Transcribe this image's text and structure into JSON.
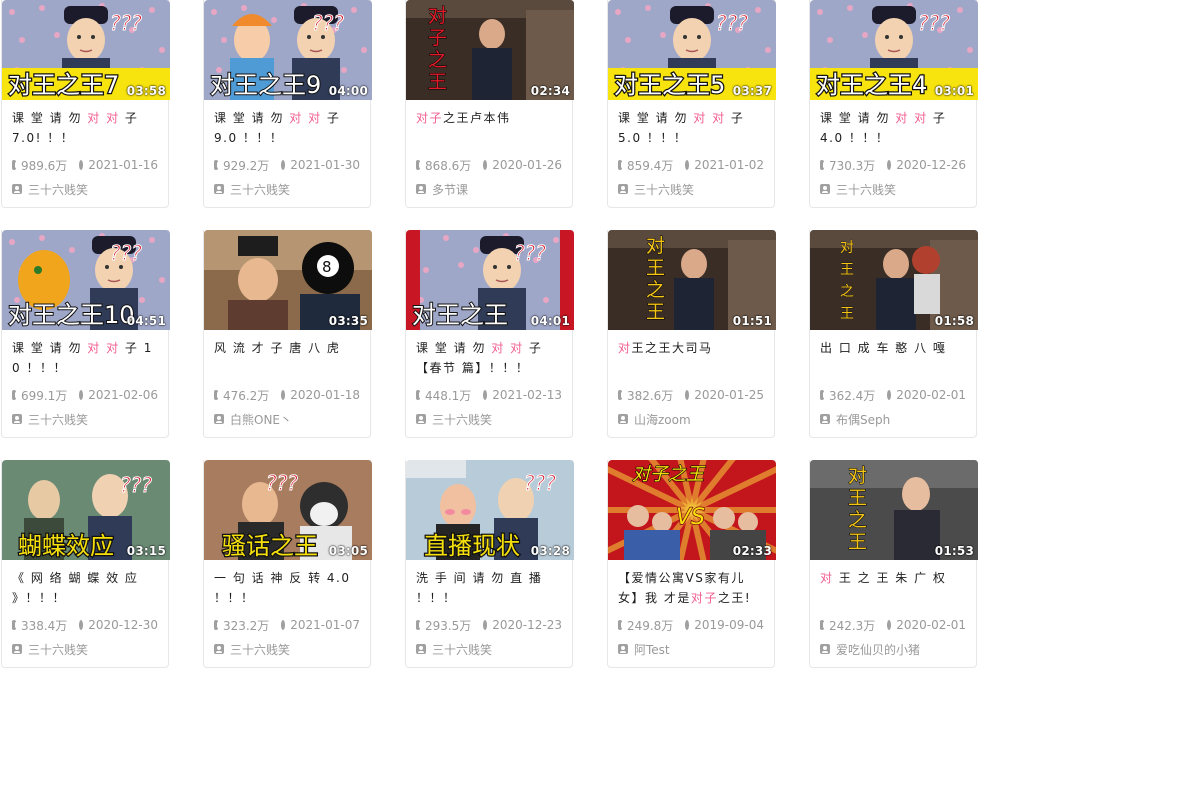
{
  "videos": [
    {
      "thumb_caption": "对王之王7",
      "duration": "03:58",
      "title": [
        [
          "课 堂 请 勿 ",
          false
        ],
        [
          "对 对",
          true
        ],
        [
          " 子 7.0! ！！",
          false
        ]
      ],
      "plays": "989.6万",
      "date": "2021-01-16",
      "uploader": "三十六贱笑",
      "theme": "teacher"
    },
    {
      "thumb_caption": "对王之王9",
      "duration": "04:00",
      "title": [
        [
          "课 堂 请 勿 ",
          false
        ],
        [
          "对 对",
          true
        ],
        [
          " 子 9.0 ！！！",
          false
        ]
      ],
      "plays": "929.2万",
      "date": "2021-01-30",
      "uploader": "三十六贱笑",
      "theme": "teacher2"
    },
    {
      "thumb_caption": "对子之王",
      "duration": "02:34",
      "title": [
        [
          "对子",
          true
        ],
        [
          "之王卢本伟",
          false
        ]
      ],
      "plays": "868.6万",
      "date": "2020-01-26",
      "uploader": "多节课",
      "theme": "drama-red"
    },
    {
      "thumb_caption": "对王之王5",
      "duration": "03:37",
      "title": [
        [
          "课 堂 请 勿 ",
          false
        ],
        [
          "对 对",
          true
        ],
        [
          " 子 5.0 ！！！",
          false
        ]
      ],
      "plays": "859.4万",
      "date": "2021-01-02",
      "uploader": "三十六贱笑",
      "theme": "teacher"
    },
    {
      "thumb_caption": "对王之王4",
      "duration": "03:01",
      "title": [
        [
          "课 堂 请 勿 ",
          false
        ],
        [
          "对 对",
          true
        ],
        [
          " 子 4.0 ！！！",
          false
        ]
      ],
      "plays": "730.3万",
      "date": "2020-12-26",
      "uploader": "三十六贱笑",
      "theme": "teacher"
    },
    {
      "thumb_caption": "对王之王10",
      "duration": "04:51",
      "title": [
        [
          "课 堂 请 勿 ",
          false
        ],
        [
          "对 对",
          true
        ],
        [
          " 子 10 ！！！",
          false
        ]
      ],
      "plays": "699.1万",
      "date": "2021-02-06",
      "uploader": "三十六贱笑",
      "theme": "teacher-dino"
    },
    {
      "thumb_caption": "",
      "duration": "03:35",
      "title": [
        [
          "风 流 才 子 唐 八 虎",
          false
        ]
      ],
      "plays": "476.2万",
      "date": "2020-01-18",
      "uploader": "白熊ONE丶",
      "theme": "ball"
    },
    {
      "thumb_caption": "对王之王",
      "duration": "04:01",
      "title": [
        [
          "课 堂 请 勿 ",
          false
        ],
        [
          "对 对",
          true
        ],
        [
          " 子 【春节 篇】！！！",
          false
        ]
      ],
      "plays": "448.1万",
      "date": "2021-02-13",
      "uploader": "三十六贱笑",
      "theme": "teacher-ny"
    },
    {
      "thumb_caption": "对王之王",
      "duration": "01:51",
      "title": [
        [
          "对",
          true
        ],
        [
          "王之王大司马",
          false
        ]
      ],
      "plays": "382.6万",
      "date": "2020-01-25",
      "uploader": "山海zoom",
      "theme": "drama-yellow"
    },
    {
      "thumb_caption": "对王之王",
      "duration": "01:58",
      "title": [
        [
          "出 口 成 车 憨 八 嘎",
          false
        ]
      ],
      "plays": "362.4万",
      "date": "2020-02-01",
      "uploader": "布偶Seph",
      "theme": "drama-anime"
    },
    {
      "thumb_caption": "蝴蝶效应",
      "duration": "03:15",
      "title": [
        [
          "《 网 络 蝴 蝶 效 应 》！！！",
          false
        ]
      ],
      "plays": "338.4万",
      "date": "2020-12-30",
      "uploader": "三十六贱笑",
      "theme": "butterfly"
    },
    {
      "thumb_caption": "骚话之王",
      "duration": "03:05",
      "title": [
        [
          "一 句 话 神 反 转 4.0 ！！！",
          false
        ]
      ],
      "plays": "323.2万",
      "date": "2021-01-07",
      "uploader": "三十六贱笑",
      "theme": "dog"
    },
    {
      "thumb_caption": "直播现状",
      "duration": "03:28",
      "title": [
        [
          "洗 手 间 请 勿 直 播 ！！！",
          false
        ]
      ],
      "plays": "293.5万",
      "date": "2020-12-23",
      "uploader": "三十六贱笑",
      "theme": "stream"
    },
    {
      "thumb_caption": "对子之王",
      "duration": "02:33",
      "title": [
        [
          "【爱情公寓VS家有儿女】我 才是",
          false
        ],
        [
          "对子",
          true
        ],
        [
          "之王!",
          false
        ]
      ],
      "plays": "249.8万",
      "date": "2019-09-04",
      "uploader": "阿Test",
      "theme": "vs"
    },
    {
      "thumb_caption": "对王之王",
      "duration": "01:53",
      "title": [
        [
          "对",
          true
        ],
        [
          " 王 之 王 朱 广 权",
          false
        ]
      ],
      "plays": "242.3万",
      "date": "2020-02-01",
      "uploader": "爱吃仙贝的小猪",
      "theme": "drama-zhu"
    }
  ],
  "colors": {
    "highlight": "#f25d8e",
    "meta_text": "#999999",
    "title_text": "#212121"
  }
}
